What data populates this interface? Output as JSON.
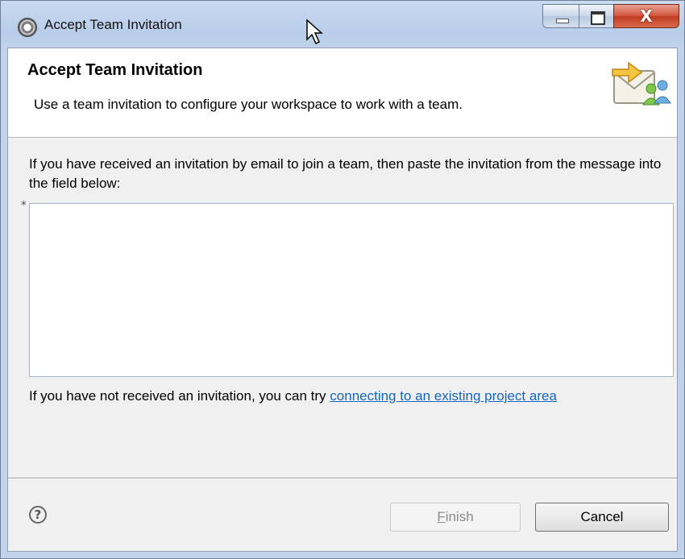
{
  "window": {
    "title": "Accept Team Invitation",
    "close_glyph": "X"
  },
  "banner": {
    "title": "Accept Team Invitation",
    "description": "Use a team invitation to configure your workspace to work with a team."
  },
  "body": {
    "intro": "If you have received an invitation by email to join a team, then paste the invitation from the message into the field below:",
    "required_marker": "*",
    "invitation_value": "",
    "alt_prefix": "If you have not received an invitation, you can try ",
    "alt_link": "connecting to an existing project area"
  },
  "footer": {
    "help_glyph": "?",
    "finish_mnemonic": "F",
    "finish_rest": "inish",
    "cancel_label": "Cancel"
  },
  "colors": {
    "link": "#1665c1",
    "disabled_text": "#8c8c8c",
    "close_button": "#c03a20"
  },
  "icons": {
    "app": "eclipse-app-icon",
    "banner": "team-invitation-envelope-icon",
    "help": "help-icon"
  }
}
